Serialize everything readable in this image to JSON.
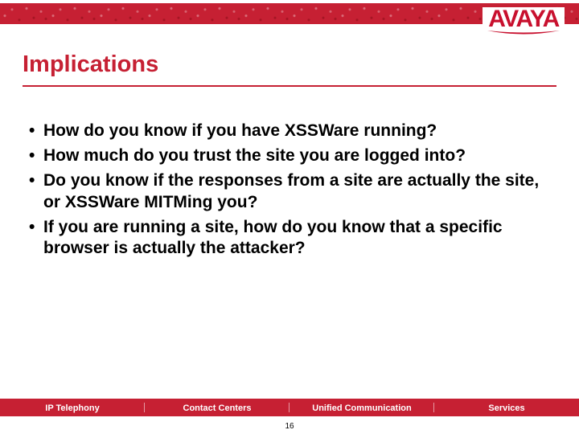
{
  "brand": {
    "name": "AVAYA",
    "color": "#c8102e"
  },
  "title": "Implications",
  "bullets": [
    "How do you know if you have XSSWare running?",
    "How much do you trust the site you are logged into?",
    "Do you know if the responses from a site are actually the site, or XSSWare MITMing you?",
    "If you are running a site, how do you know that a specific browser is actually the attacker?"
  ],
  "footer": {
    "segments": [
      "IP Telephony",
      "Contact Centers",
      "Unified Communication",
      "Services"
    ]
  },
  "page_number": "16"
}
